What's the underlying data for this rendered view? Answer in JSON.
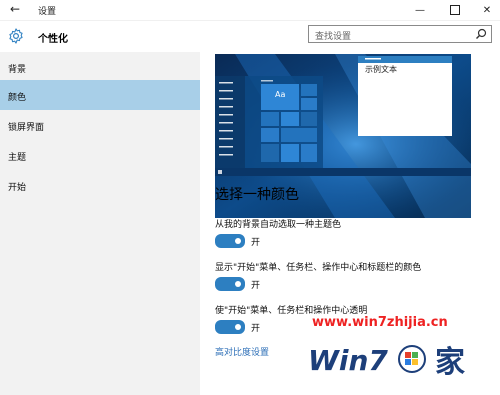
{
  "window": {
    "title": "设置",
    "back_glyph": "←",
    "min_glyph": "—",
    "close_glyph": "✕"
  },
  "header": {
    "section_title": "个性化",
    "search_placeholder": "查找设置"
  },
  "sidebar": {
    "items": [
      {
        "label": "背景",
        "selected": false
      },
      {
        "label": "颜色",
        "selected": true
      },
      {
        "label": "锁屏界面",
        "selected": false
      },
      {
        "label": "主题",
        "selected": false
      },
      {
        "label": "开始",
        "selected": false
      }
    ]
  },
  "preview": {
    "tile_text": "Aa",
    "sample_text": "示例文本"
  },
  "main": {
    "heading": "选择一种颜色",
    "options": [
      {
        "label": "从我的背景自动选取一种主题色",
        "state": "开",
        "on": true
      },
      {
        "label": "显示\"开始\"菜单、任务栏、操作中心和标题栏的颜色",
        "state": "开",
        "on": true
      },
      {
        "label": "使\"开始\"菜单、任务栏和操作中心透明",
        "state": "开",
        "on": true
      }
    ],
    "link": "高对比度设置"
  },
  "watermark": {
    "url": "www.win7zhijia.cn",
    "logo_text": "Win7",
    "logo_suffix": "家"
  },
  "colors": {
    "accent": "#2d7fc1",
    "sidebar_bg": "#f2f2f2",
    "selected_bg": "#a8cfe8",
    "link": "#2d6fb7"
  }
}
